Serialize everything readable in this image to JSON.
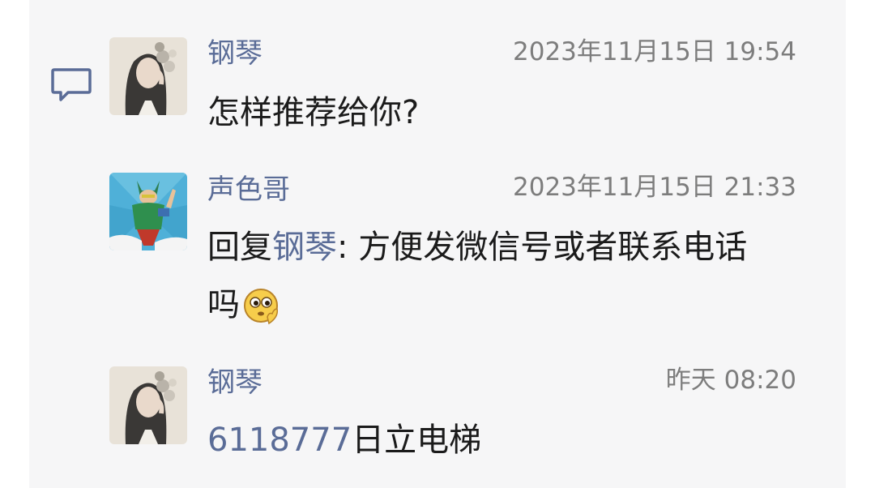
{
  "comments": [
    {
      "author": "钢琴",
      "time": "2023年11月15日 19:54",
      "text": "怎样推荐给你?"
    },
    {
      "author": "声色哥",
      "time": "2023年11月15日 21:33",
      "reply_prefix": "回复",
      "reply_to": "钢琴",
      "reply_sep": ": ",
      "text_line1": "方便发微信号或者联系电话",
      "text_line2": "吗",
      "emoji": "thinking-face-emoji"
    },
    {
      "author": "钢琴",
      "time": "昨天 08:20",
      "phone": "6118777",
      "text": "日立电梯"
    }
  ],
  "icons": {
    "comment": "comment-bubble-icon"
  },
  "colors": {
    "name": "#5a6c97",
    "time": "#7d7d7d",
    "text": "#1b1b1b",
    "panel": "#f6f6f7"
  }
}
